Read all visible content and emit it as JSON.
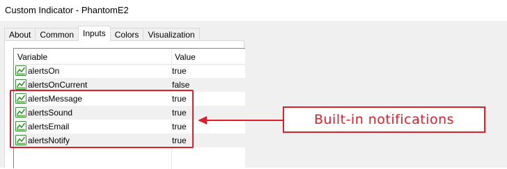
{
  "window": {
    "title": "Custom Indicator - PhantomE2"
  },
  "tabs": [
    {
      "label": "About",
      "active": false
    },
    {
      "label": "Common",
      "active": false
    },
    {
      "label": "Inputs",
      "active": true
    },
    {
      "label": "Colors",
      "active": false
    },
    {
      "label": "Visualization",
      "active": false
    }
  ],
  "table": {
    "headers": {
      "variable": "Variable",
      "value": "Value"
    },
    "rows": [
      {
        "variable": "alertsOn",
        "value": "true",
        "icon": "boolean-param-icon"
      },
      {
        "variable": "alertsOnCurrent",
        "value": "false",
        "icon": "boolean-param-icon"
      },
      {
        "variable": "alertsMessage",
        "value": "true",
        "icon": "boolean-param-icon"
      },
      {
        "variable": "alertsSound",
        "value": "true",
        "icon": "boolean-param-icon"
      },
      {
        "variable": "alertsEmail",
        "value": "true",
        "icon": "boolean-param-icon"
      },
      {
        "variable": "alertsNotify",
        "value": "true",
        "icon": "boolean-param-icon"
      }
    ]
  },
  "annotation": {
    "label": "Built-in notifications",
    "color": "#e01e2b"
  }
}
